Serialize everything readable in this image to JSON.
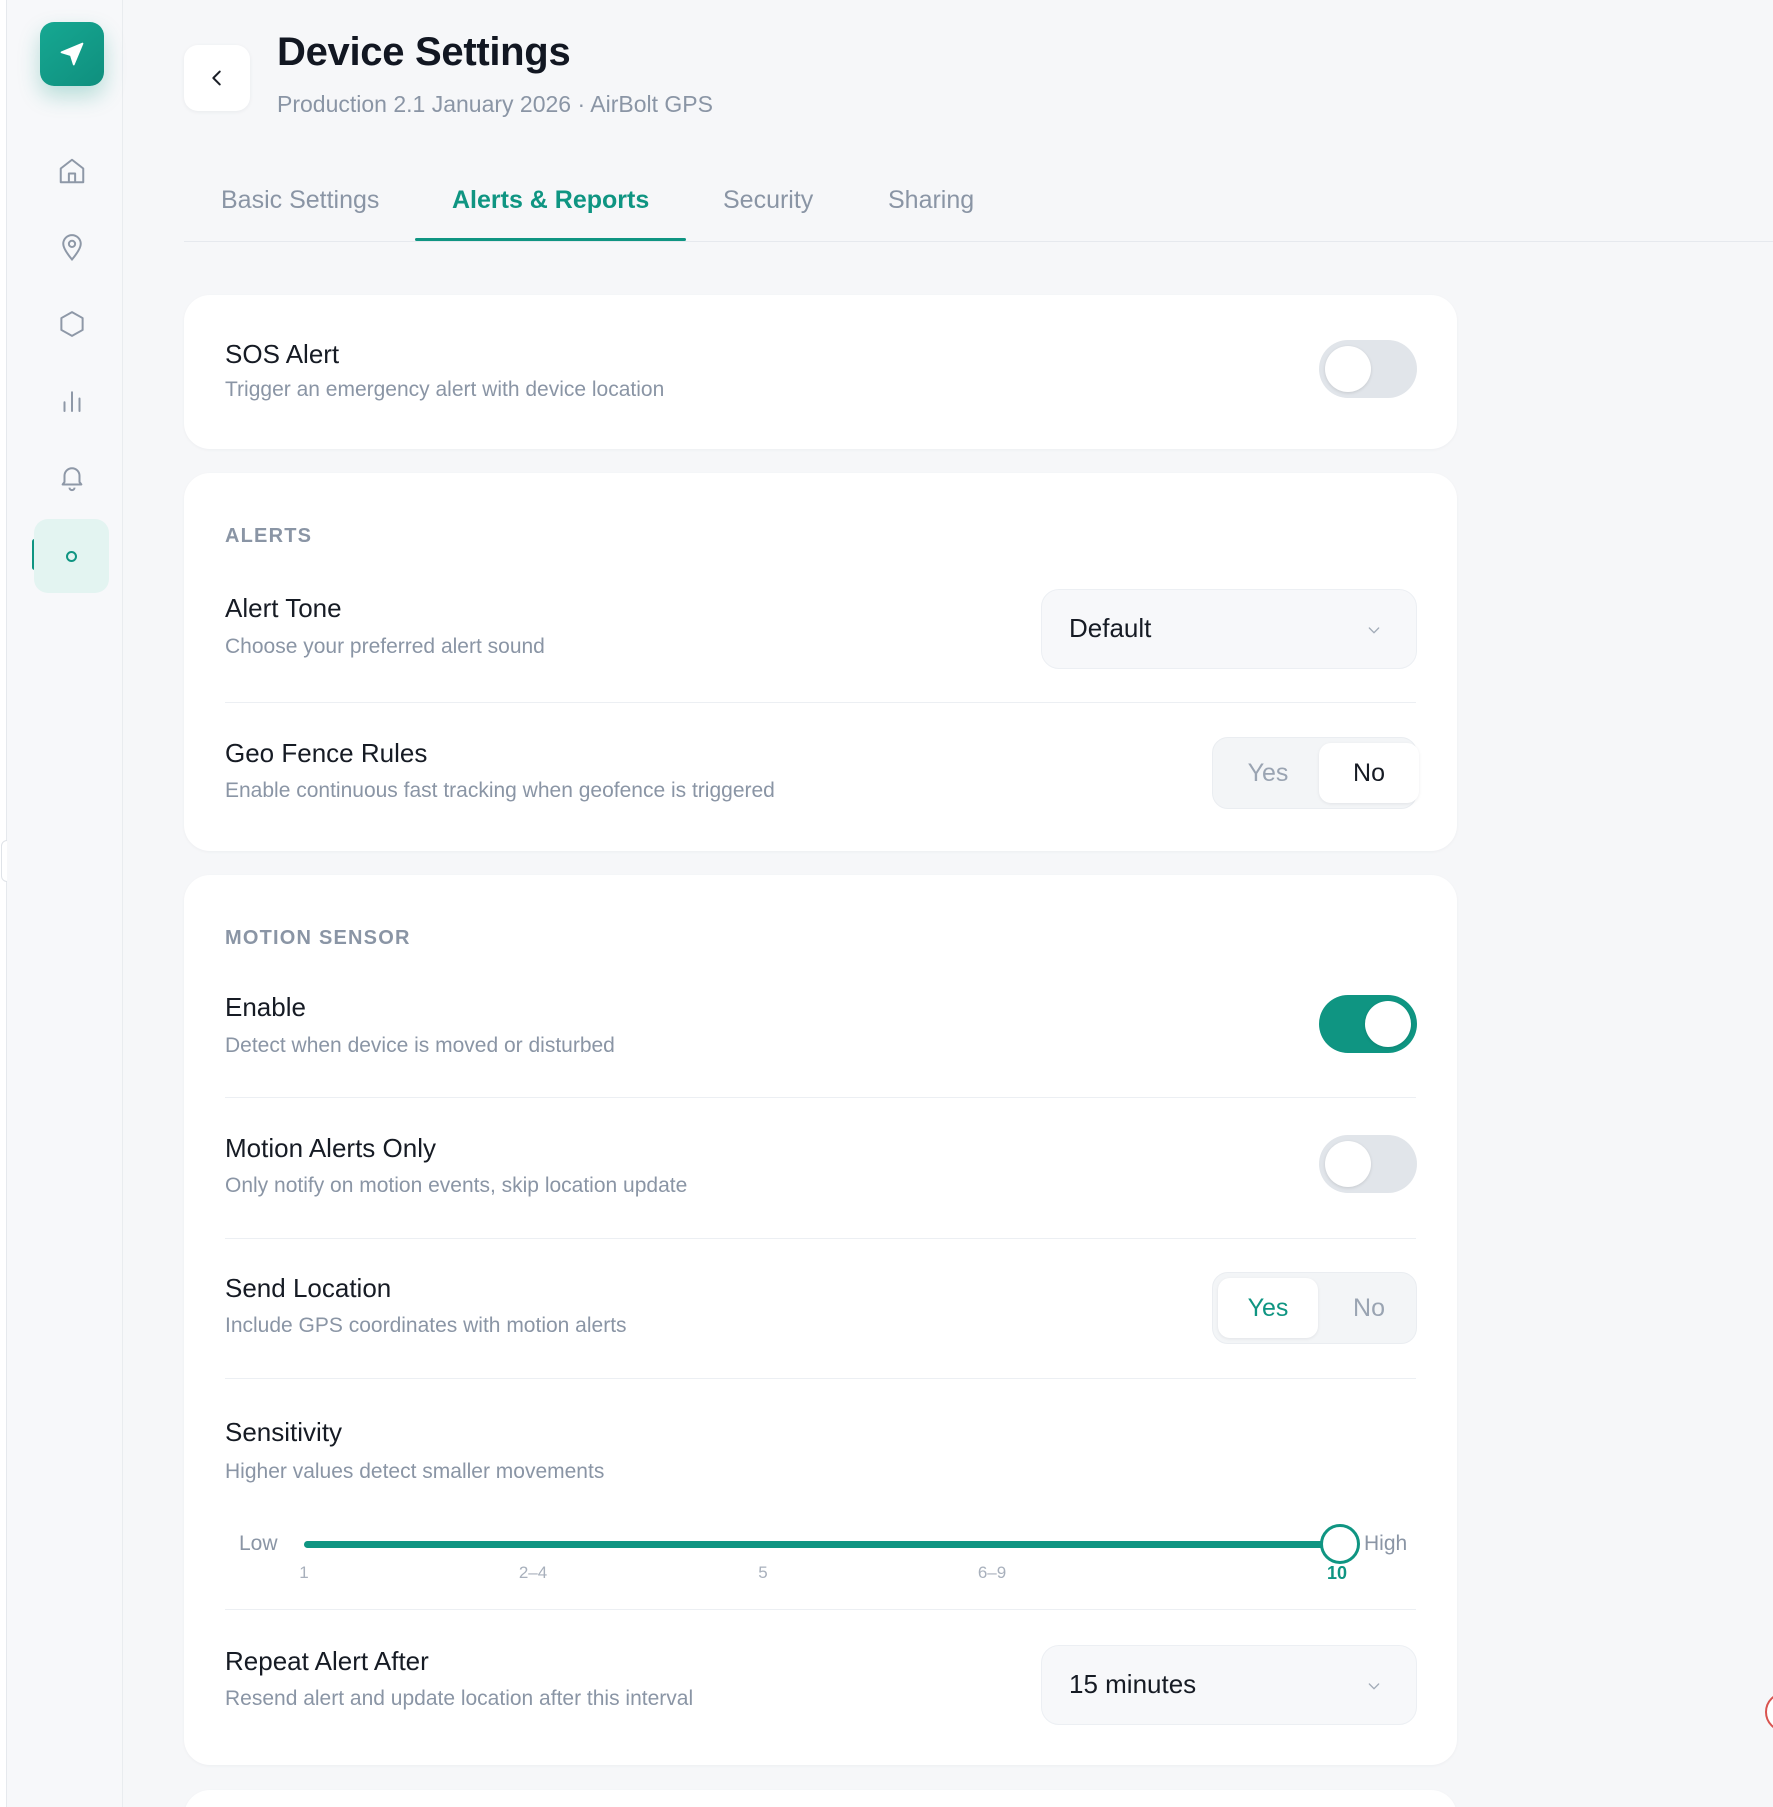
{
  "header": {
    "title": "Device Settings",
    "subtitle": "Production 2.1 January 2026 · AirBolt GPS"
  },
  "sidebar": {
    "items": [
      {
        "icon": "home-icon"
      },
      {
        "icon": "map-pin-icon"
      },
      {
        "icon": "hexagon-icon"
      },
      {
        "icon": "bar-chart-icon"
      },
      {
        "icon": "bell-icon"
      },
      {
        "icon": "settings-icon",
        "active": true
      }
    ]
  },
  "tabs": [
    {
      "label": "Basic Settings"
    },
    {
      "label": "Alerts & Reports",
      "active": true
    },
    {
      "label": "Security"
    },
    {
      "label": "Sharing"
    }
  ],
  "sos": {
    "title": "SOS Alert",
    "description": "Trigger an emergency alert with device location",
    "enabled": false
  },
  "alerts": {
    "section": "ALERTS",
    "tone": {
      "title": "Alert Tone",
      "description": "Choose your preferred alert sound",
      "value": "Default"
    },
    "geofence": {
      "title": "Geo Fence Rules",
      "description": "Enable continuous fast tracking when geofence is triggered",
      "yes": "Yes",
      "no": "No",
      "selected": "No"
    }
  },
  "motion": {
    "section": "MOTION SENSOR",
    "enable": {
      "title": "Enable",
      "description": "Detect when device is moved or disturbed",
      "enabled": true
    },
    "alerts_only": {
      "title": "Motion Alerts Only",
      "description": "Only notify on motion events, skip location update",
      "enabled": false
    },
    "send_location": {
      "title": "Send Location",
      "description": "Include GPS coordinates with motion alerts",
      "yes": "Yes",
      "no": "No",
      "selected": "Yes"
    },
    "sensitivity": {
      "title": "Sensitivity",
      "description": "Higher values detect smaller movements",
      "low_label": "Low",
      "high_label": "High",
      "ticks": [
        "1",
        "2–4",
        "5",
        "6–9",
        "10"
      ],
      "value_fraction": 1.0
    },
    "repeat": {
      "title": "Repeat Alert After",
      "description": "Resend alert and update location after this interval",
      "value": "15 minutes"
    }
  },
  "colors": {
    "accent": "#0f9582",
    "muted_text": "#8a95a5",
    "background": "#f6f7f9"
  }
}
